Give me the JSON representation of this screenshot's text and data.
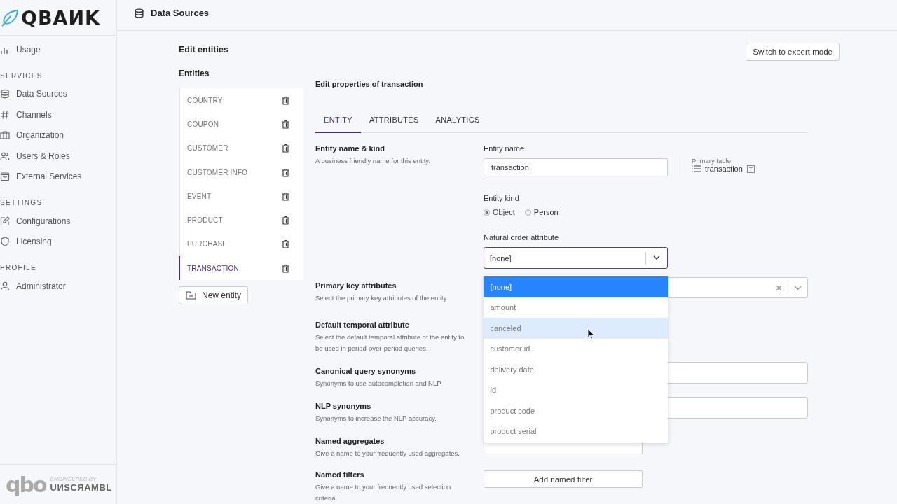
{
  "logo": {
    "text": "QBAИK"
  },
  "sidebar": {
    "sections": [
      {
        "items": [
          {
            "label": "Usage"
          }
        ]
      },
      {
        "heading": "SERVICES",
        "items": [
          {
            "label": "Data Sources"
          },
          {
            "label": "Channels"
          },
          {
            "label": "Organization"
          },
          {
            "label": "Users & Roles"
          },
          {
            "label": "External Services"
          }
        ]
      },
      {
        "heading": "SETTINGS",
        "items": [
          {
            "label": "Configurations"
          },
          {
            "label": "Licensing"
          }
        ]
      },
      {
        "heading": "PROFILE",
        "items": [
          {
            "label": "Administrator"
          }
        ]
      }
    ],
    "footer": {
      "mark": "qbo",
      "tagline": "ENGINEERED BY",
      "company": "UИSCЯAMBL"
    }
  },
  "header": {
    "title": "Data Sources"
  },
  "page": {
    "title": "Edit entities",
    "expert_button": "Switch to expert mode"
  },
  "entities": {
    "heading": "Entities",
    "items": [
      {
        "label": "COUNTRY",
        "selected": false
      },
      {
        "label": "COUPON",
        "selected": false
      },
      {
        "label": "CUSTOMER",
        "selected": false
      },
      {
        "label": "CUSTOMER INFO",
        "selected": false
      },
      {
        "label": "EVENT",
        "selected": false
      },
      {
        "label": "PRODUCT",
        "selected": false
      },
      {
        "label": "PURCHASE",
        "selected": false
      },
      {
        "label": "TRANSACTION",
        "selected": true
      }
    ],
    "new_button": "New entity"
  },
  "editor": {
    "title": "Edit properties of transaction",
    "tabs": [
      {
        "label": "ENTITY",
        "selected": true
      },
      {
        "label": "ATTRIBUTES",
        "selected": false
      },
      {
        "label": "ANALYTICS",
        "selected": false
      }
    ],
    "name_kind": {
      "title": "Entity name & kind",
      "description": "A business friendly name for this entity.",
      "name_label": "Entity name",
      "name_value": "transaction",
      "primary_table_label": "Primary table",
      "primary_table": "transaction",
      "kind_label": "Entity kind",
      "kinds": [
        {
          "label": "Object",
          "selected": true
        },
        {
          "label": "Person",
          "selected": false
        }
      ],
      "order_label": "Natural order attribute",
      "order_value": "[none]",
      "order_options": [
        {
          "label": "[none]",
          "selected": true,
          "hovered": false
        },
        {
          "label": "amount",
          "selected": false,
          "hovered": false
        },
        {
          "label": "canceled",
          "selected": false,
          "hovered": true
        },
        {
          "label": "customer id",
          "selected": false,
          "hovered": false
        },
        {
          "label": "delivery date",
          "selected": false,
          "hovered": false
        },
        {
          "label": "id",
          "selected": false,
          "hovered": false
        },
        {
          "label": "product code",
          "selected": false,
          "hovered": false
        },
        {
          "label": "product serial",
          "selected": false,
          "hovered": false
        }
      ]
    },
    "sections": [
      {
        "kind": "multiselect",
        "title": "Primary key attributes",
        "description": "Select the primary key attributes of the entity"
      },
      {
        "kind": "hidden",
        "title": "Default temporal attribute",
        "description": "Select the default temporal attribute of the entity to be used in period-over-period queries."
      },
      {
        "kind": "field",
        "title": "Canonical query synonyms",
        "description": "Synonyms to use autocompletion and NLP."
      },
      {
        "kind": "field",
        "title": "NLP synonyms",
        "description": "Synonyms to increase the NLP accuracy."
      },
      {
        "kind": "button",
        "title": "Named aggregates",
        "description": "Give a name to your frequently used aggregates."
      },
      {
        "kind": "button",
        "title": "Named filters",
        "description": "Give a name to your frequently used selection criteria.",
        "button": "Add named filter"
      }
    ]
  }
}
